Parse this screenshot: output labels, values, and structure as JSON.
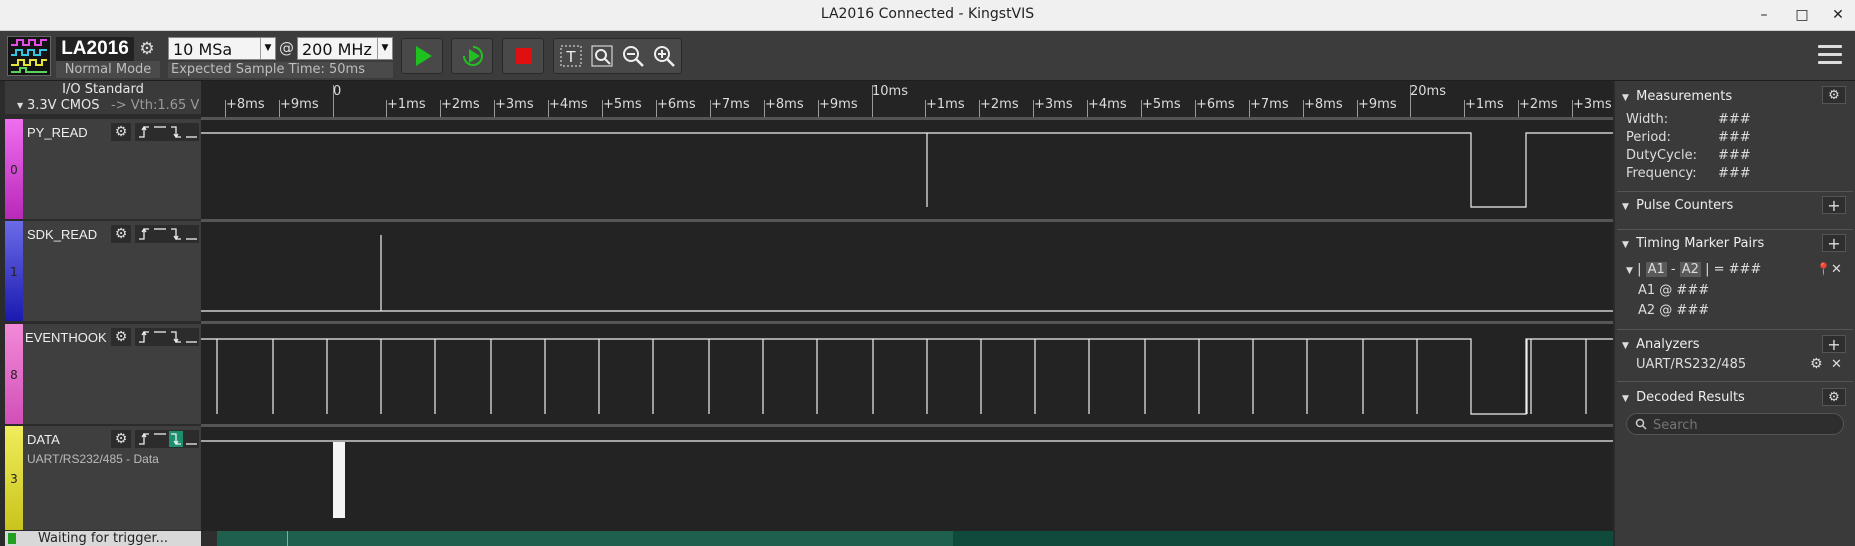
{
  "window": {
    "title": "LA2016 Connected - KingstVIS",
    "minimize": "–",
    "maximize": "□",
    "close": "✕"
  },
  "toolbar": {
    "device_name": "LA2016",
    "device_mode": "Normal Mode",
    "sample_depth": "10 MSa",
    "at_symbol": "@",
    "sample_rate": "200 MHz",
    "expected_time": "Expected Sample Time: 50ms",
    "icons": [
      "device-logo-icon",
      "gear-icon",
      "run-icon",
      "run-repeat-icon",
      "stop-icon",
      "text-cursor-icon",
      "zoom-fit-icon",
      "zoom-out-icon",
      "zoom-in-icon",
      "hamburger-menu-icon"
    ],
    "colors": {
      "run": "#20c020",
      "stop": "#e01010"
    }
  },
  "io": {
    "title": "I/O Standard",
    "standard": "3.3V CMOS",
    "vth": "-> Vth:1.65 V"
  },
  "channels": [
    {
      "index": "0",
      "name": "PY_READ",
      "sub": "",
      "color": "#e04ee0"
    },
    {
      "index": "1",
      "name": "SDK_READ",
      "sub": "",
      "color": "#2a2ad4"
    },
    {
      "index": "8",
      "name": "EVENTHOOK",
      "sub": "",
      "color": "#ee66cc"
    },
    {
      "index": "3",
      "name": "DATA",
      "sub": "UART/RS232/485 - Data",
      "color": "#e8e33a"
    }
  ],
  "ruler": {
    "labels": [
      "+8ms",
      "+9ms",
      "0",
      "+1ms",
      "+2ms",
      "+3ms",
      "+4ms",
      "+5ms",
      "+6ms",
      "+7ms",
      "+8ms",
      "+9ms",
      "10ms",
      "+1ms",
      "+2ms",
      "+3ms",
      "+4ms",
      "+5ms",
      "+6ms",
      "+7ms",
      "+8ms",
      "+9ms",
      "20ms",
      "+1ms",
      "+2ms",
      "+3ms"
    ]
  },
  "panel": {
    "measurements": {
      "title": "Measurements",
      "rows": [
        {
          "label": "Width:",
          "value": "###"
        },
        {
          "label": "Period:",
          "value": "###"
        },
        {
          "label": "DutyCycle:",
          "value": "###"
        },
        {
          "label": "Frequency:",
          "value": "###"
        }
      ]
    },
    "pulse_counters": {
      "title": "Pulse Counters"
    },
    "timing": {
      "title": "Timing Marker Pairs",
      "pair_bar": "|",
      "a1": "A1",
      "minus": "-",
      "a2": "A2",
      "equals": "| = ###",
      "a1_row": "A1 @ ###",
      "a2_row": "A2 @ ###"
    },
    "analyzers": {
      "title": "Analyzers",
      "item": "UART/RS232/485"
    },
    "decoded": {
      "title": "Decoded Results",
      "search_placeholder": "Search"
    }
  },
  "status": {
    "text": "Waiting for trigger..."
  }
}
